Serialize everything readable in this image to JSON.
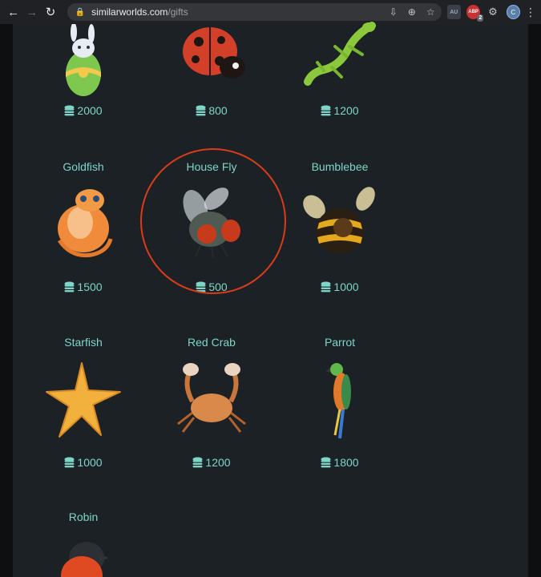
{
  "browser": {
    "url_host": "similarworlds.com",
    "url_path": "/gifts",
    "extensions": [
      {
        "name": "au-extension",
        "label": "AU"
      },
      {
        "name": "adblock-extension",
        "label": "ABP",
        "badge": "2"
      }
    ],
    "profile_initial": "C"
  },
  "gifts": [
    {
      "id": "bunny",
      "name": "",
      "price": "2000"
    },
    {
      "id": "ladybug",
      "name": "",
      "price": "800"
    },
    {
      "id": "lizard",
      "name": "",
      "price": "1200"
    },
    {
      "id": "goldfish",
      "name": "Goldfish",
      "price": "1500"
    },
    {
      "id": "house-fly",
      "name": "House Fly",
      "price": "500"
    },
    {
      "id": "bumblebee",
      "name": "Bumblebee",
      "price": "1000"
    },
    {
      "id": "starfish",
      "name": "Starfish",
      "price": "1000"
    },
    {
      "id": "red-crab",
      "name": "Red Crab",
      "price": "1200"
    },
    {
      "id": "parrot",
      "name": "Parrot",
      "price": "1800"
    },
    {
      "id": "robin",
      "name": "Robin",
      "price": ""
    }
  ],
  "colors": {
    "accent_text": "#7fd4c8",
    "panel_bg": "#1c2125",
    "highlight": "#d93b1c"
  }
}
